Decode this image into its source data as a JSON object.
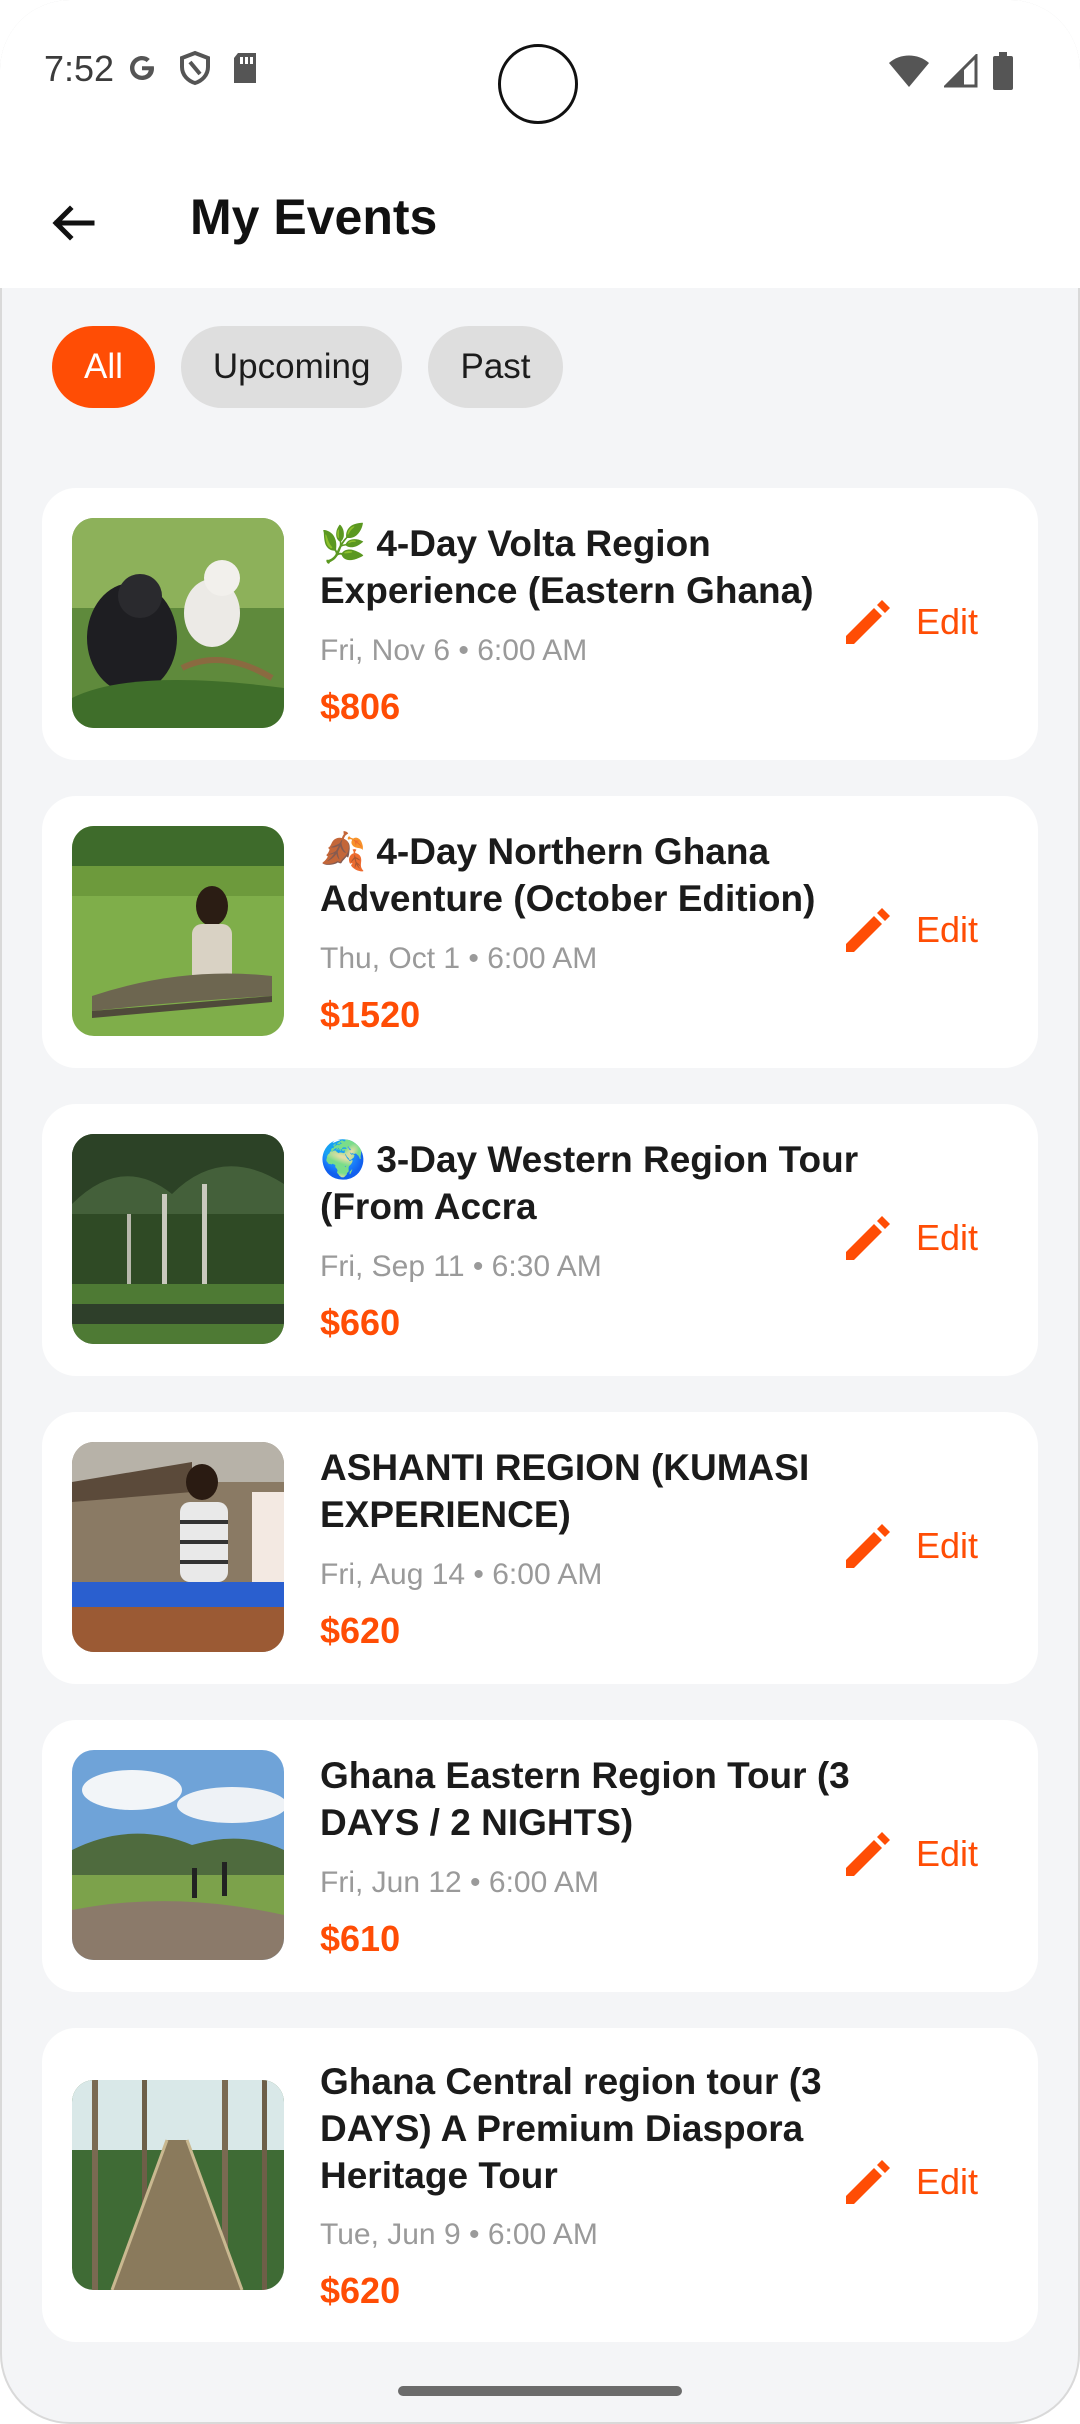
{
  "status_bar": {
    "time": "7:52"
  },
  "header": {
    "title": "My Events"
  },
  "filters": [
    {
      "label": "All",
      "active": true
    },
    {
      "label": "Upcoming",
      "active": false
    },
    {
      "label": "Past",
      "active": false
    }
  ],
  "events": [
    {
      "emoji": "🌿",
      "title": "4-Day Volta Region Experience (Eastern Ghana)",
      "date": "Fri, Nov 6 • 6:00 AM",
      "price": "$806",
      "edit_label": "Edit"
    },
    {
      "emoji": "🍂",
      "title": "4-Day Northern Ghana Adventure (October Edition)",
      "date": "Thu, Oct 1 • 6:00 AM",
      "price": "$1520",
      "edit_label": "Edit"
    },
    {
      "emoji": "🌍",
      "title": "3-Day Western Region Tour (From Accra",
      "date": "Fri, Sep 11 • 6:30 AM",
      "price": "$660",
      "edit_label": "Edit"
    },
    {
      "emoji": "",
      "title": "ASHANTI REGION (KUMASI EXPERIENCE)",
      "date": "Fri, Aug 14 • 6:00 AM",
      "price": "$620",
      "edit_label": "Edit"
    },
    {
      "emoji": "",
      "title": "Ghana Eastern Region Tour (3 DAYS / 2 NIGHTS)",
      "date": "Fri, Jun 12 • 6:00 AM",
      "price": "$610",
      "edit_label": "Edit"
    },
    {
      "emoji": "",
      "title": "Ghana Central region tour (3 DAYS) A Premium Diaspora Heritage Tour",
      "date": "Tue, Jun 9 • 6:00 AM",
      "price": "$620",
      "edit_label": "Edit"
    }
  ],
  "colors": {
    "accent": "#ff4d05",
    "chip_inactive": "#dedede",
    "background": "#f4f5f7"
  }
}
